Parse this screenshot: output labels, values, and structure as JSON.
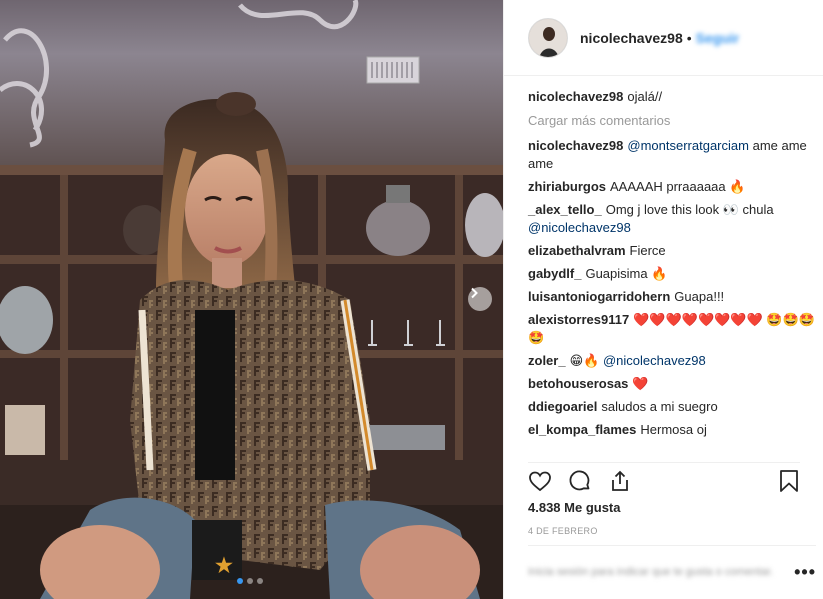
{
  "post": {
    "username": "nicolechavez98",
    "header_separator": "•",
    "follow_label": "Seguir",
    "caption": {
      "user": "nicolechavez98",
      "text": "ojalá//"
    },
    "load_more_label": "Cargar más comentarios",
    "comments": [
      {
        "user": "nicolechavez98",
        "mention": "@montserratgarciam",
        "text": "ame ame ame"
      },
      {
        "user": "zhiriaburgos",
        "text": "AAAAAH prraaaaaa 🔥"
      },
      {
        "user": "_alex_tello_",
        "text": "Omg j love this look 👀 chula",
        "mention_after": "@nicolechavez98"
      },
      {
        "user": "elizabethalvram",
        "text": "Fierce"
      },
      {
        "user": "gabydlf_",
        "text": "Guapisima 🔥"
      },
      {
        "user": "luisantoniogarridohern",
        "text": "Guapa!!!"
      },
      {
        "user": "alexistorres9117",
        "text": "❤️❤️❤️❤️❤️❤️❤️❤️ 🤩🤩🤩🤩"
      },
      {
        "user": "zoler_",
        "text": "😁🔥",
        "mention_after": "@nicolechavez98"
      },
      {
        "user": "betohouserosas",
        "text": "❤️"
      },
      {
        "user": "ddiegoariel",
        "text": "saludos a mi suegro"
      },
      {
        "user": "el_kompa_flames",
        "text": "Hermosa oj"
      }
    ],
    "likes": "4.838 Me gusta",
    "date": "4 de febrero",
    "comment_box_text": "Inicia sesión para indicar que te gusta o comentar.",
    "more_label": "•••"
  },
  "icons": [
    "heart-icon",
    "comment-icon",
    "share-icon",
    "bookmark-icon",
    "chevron-right-icon",
    "more-icon"
  ]
}
